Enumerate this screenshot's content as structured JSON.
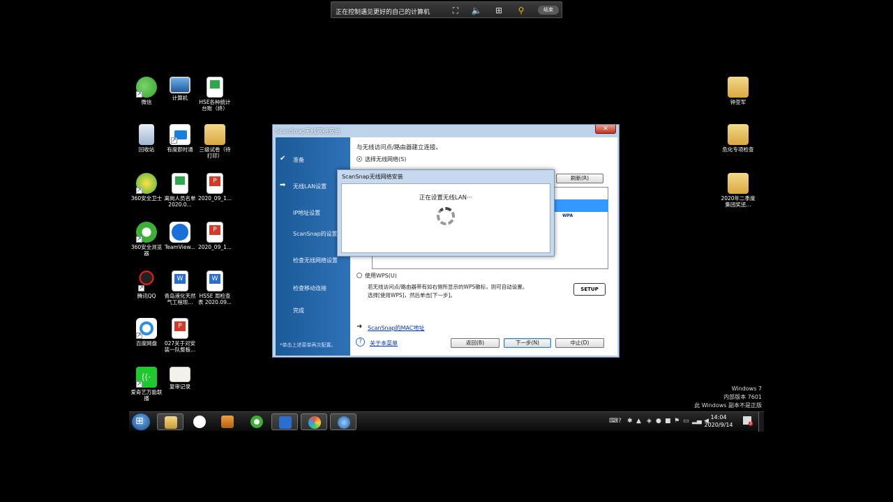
{
  "remote": {
    "title": "正在控制遇见更好的自己的计算机",
    "end_label": "结束"
  },
  "desktop": {
    "icons": [
      {
        "label": "微信"
      },
      {
        "label": "计算机"
      },
      {
        "label": "HSE各种统计台账（终）"
      },
      {
        "label": "回收站"
      },
      {
        "label": "有度即时通"
      },
      {
        "label": "三级试卷（待打印）"
      },
      {
        "label": "360安全卫士"
      },
      {
        "label": "离岗人员名单2020.0..."
      },
      {
        "label": "2020_09_1..."
      },
      {
        "label": "360安全浏览器"
      },
      {
        "label": "TeamView..."
      },
      {
        "label": "2020_09_1..."
      },
      {
        "label": "腾讯QQ"
      },
      {
        "label": "青岛液化天然气工程现..."
      },
      {
        "label": "HSSE 周检查表 2020.09..."
      },
      {
        "label": "百度网盘"
      },
      {
        "label": "027关于对安装一队整板..."
      },
      {
        "label": "爱奇艺万能联播"
      },
      {
        "label": "复审记录"
      },
      {
        "label": "钟亚军"
      },
      {
        "label": "危化专项检查"
      },
      {
        "label": "2020年二季度集团奖惩..."
      }
    ]
  },
  "wizard": {
    "title": "ScanSnap无线网络安装",
    "close": "✕",
    "steps": [
      {
        "label": "准备",
        "mark": "✔"
      },
      {
        "label": "无线LAN设置",
        "mark": "➡"
      },
      {
        "label": "IP地址设置"
      },
      {
        "label": "ScanSnap的设置"
      },
      {
        "label": "检查无线网络设置"
      },
      {
        "label": "检查移动连接"
      },
      {
        "label": "完成"
      }
    ],
    "steps_footer": "*单击上述菜单再次配置。",
    "heading": "与无线访问点/路由器建立连接。",
    "option_select": "选择无线网络(S)",
    "refresh_label": "刷新(R)",
    "wpa_label": "WPA",
    "option_wps": "使用WPS(U)",
    "wps_desc_line1": "若无线访问点/路由器带有如右侧所显示的WPS徽标，则可自动设置。",
    "wps_desc_line2": "选择[使用WPS]，然后单击[下一步]。",
    "wps_logo": "SETUP",
    "mac_link": "ScanSnap的MAC地址",
    "help_link": "关于本菜单",
    "back_label": "返回(B)",
    "next_label": "下一步(N)",
    "abort_label": "中止(D)"
  },
  "progress": {
    "title": "ScanSnap无线网络安装",
    "message": "正在设置无线LAN···"
  },
  "watermark": {
    "line1": "Windows 7",
    "line2": "内部版本 7601",
    "line3": "此 Windows 副本不是正版"
  },
  "taskbar": {
    "time": "14:04",
    "date": "2020/9/14",
    "badge": "3"
  }
}
